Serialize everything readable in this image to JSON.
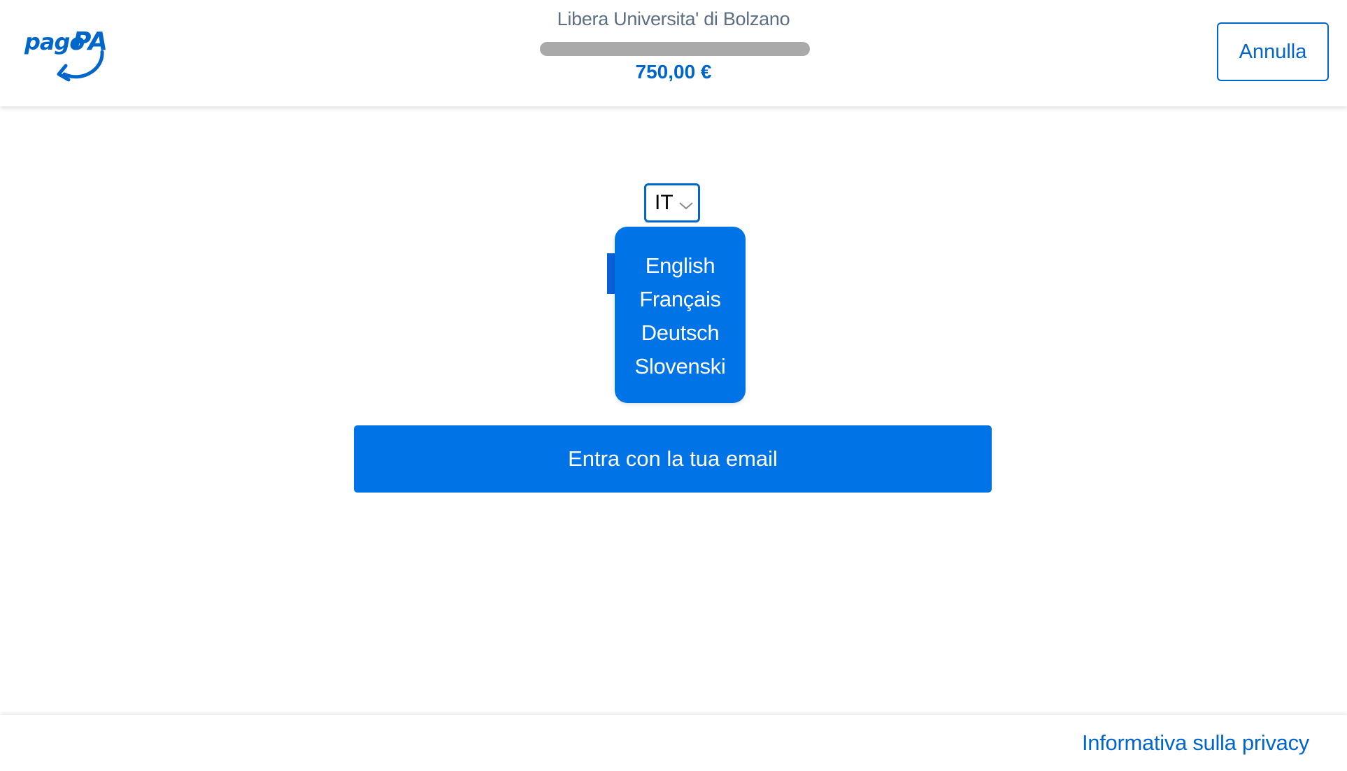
{
  "header": {
    "logo_text": "pagoPA",
    "creditor_name": "Libera Universita' di Bolzano",
    "notice_code": "",
    "amount": "750,00 €",
    "cancel_label": "Annulla"
  },
  "language": {
    "selected": "IT",
    "options": [
      "English",
      "Français",
      "Deutsch",
      "Slovenski"
    ]
  },
  "main": {
    "email_button_label": "Entra con la tua email"
  },
  "footer": {
    "privacy_label": "Informativa sulla privacy"
  },
  "colors": {
    "primary": "#0066cc",
    "button_blue": "#0073e6",
    "text_gray": "#5c6f82"
  }
}
